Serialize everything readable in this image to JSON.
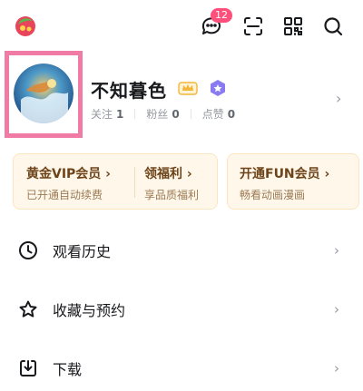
{
  "top_bar": {
    "icons": [
      "app-logo",
      "message-icon",
      "scan-icon",
      "qr-code-icon",
      "search-icon"
    ],
    "message_badge": "12"
  },
  "profile": {
    "username": "不知暮色",
    "stats": [
      {
        "label": "关注",
        "value": "1"
      },
      {
        "label": "粉丝",
        "value": "0"
      },
      {
        "label": "点赞",
        "value": "0"
      }
    ]
  },
  "cards": {
    "vip": {
      "title": "黄金VIP会员",
      "subtitle": "已开通自动续费"
    },
    "welfare": {
      "title": "领福利",
      "subtitle": "享品质福利"
    },
    "fun": {
      "title": "开通FUN会员",
      "subtitle": "畅看动画漫画"
    }
  },
  "menu": [
    {
      "label": "观看历史",
      "icon": "clock-icon"
    },
    {
      "label": "收藏与预约",
      "icon": "star-icon"
    },
    {
      "label": "下载",
      "icon": "download-icon"
    }
  ],
  "colors": {
    "accent_pink": "#ff4f7b",
    "highlight_border": "#f07ba4",
    "card_bg": "#fff7ea",
    "card_text": "#6d4419"
  }
}
